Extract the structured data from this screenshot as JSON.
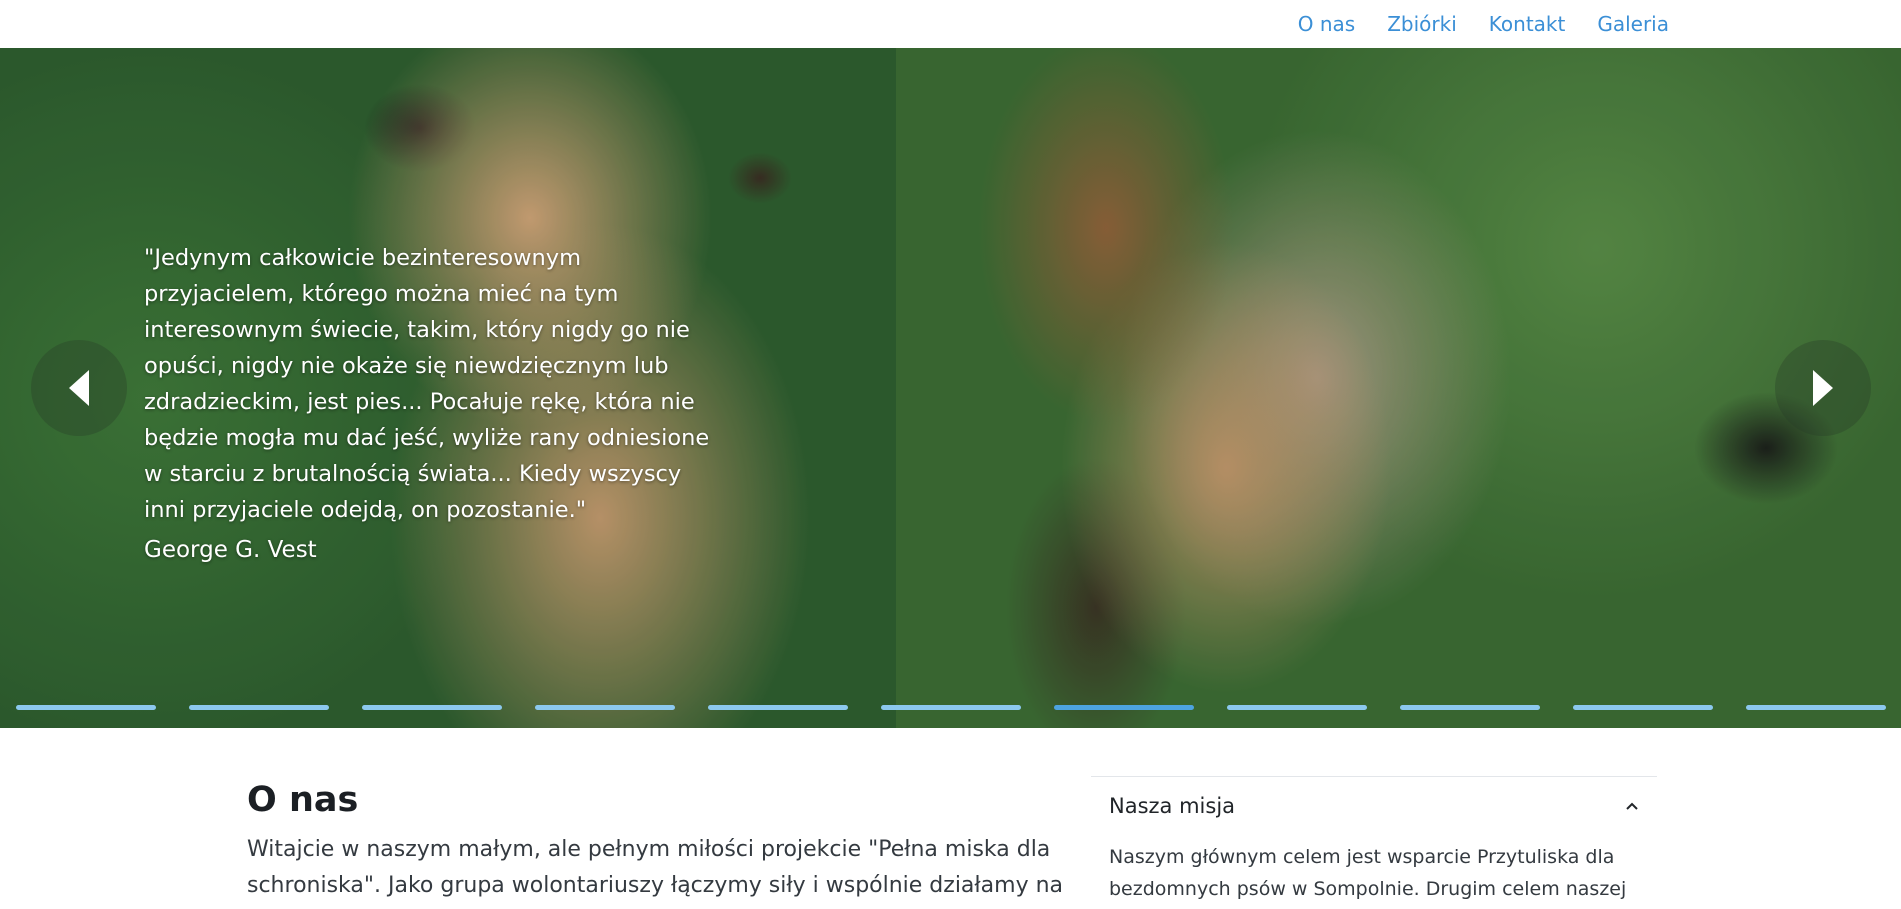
{
  "nav": {
    "items": [
      {
        "label": "O nas"
      },
      {
        "label": "Zbiórki"
      },
      {
        "label": "Kontakt"
      },
      {
        "label": "Galeria"
      }
    ]
  },
  "hero": {
    "quote": "\"Jedynym całkowicie bezinteresownym przyjacielem, którego można mieć na tym interesownym świecie, takim, który nigdy go nie opuści, nigdy nie okaże się niewdzięcznym lub zdradzieckim, jest pies... Pocałuje rękę, która nie będzie mogła mu dać jeść, wyliże rany odniesione w starciu z brutalnością świata... Kiedy wszyscy inni przyjaciele odejdą, on pozostanie.\"",
    "author": "George G. Vest",
    "prev_icon": "chevron-left-icon",
    "next_icon": "chevron-right-icon",
    "slide_count": 11,
    "active_slide": 7,
    "indicator_color": "#8cc8ee",
    "indicator_active_color": "#4da3e0"
  },
  "about": {
    "title": "O nas",
    "text": "Witajcie w naszym małym, ale pełnym miłości projekcie \"Pełna miska dla schroniska\". Jako grupa wolontariuszy łączymy siły i wspólnie działamy na rzecz"
  },
  "accordion": {
    "title": "Nasza misja",
    "toggle_icon": "chevron-up-icon",
    "body": "Naszym głównym celem jest wsparcie Przytuliska dla bezdomnych psów w Sompolnie. Drugim celem naszej inicjatywy jest podnoszenie świadomości społecznej"
  },
  "colors": {
    "link": "#3b8fd6",
    "text": "#212529"
  }
}
